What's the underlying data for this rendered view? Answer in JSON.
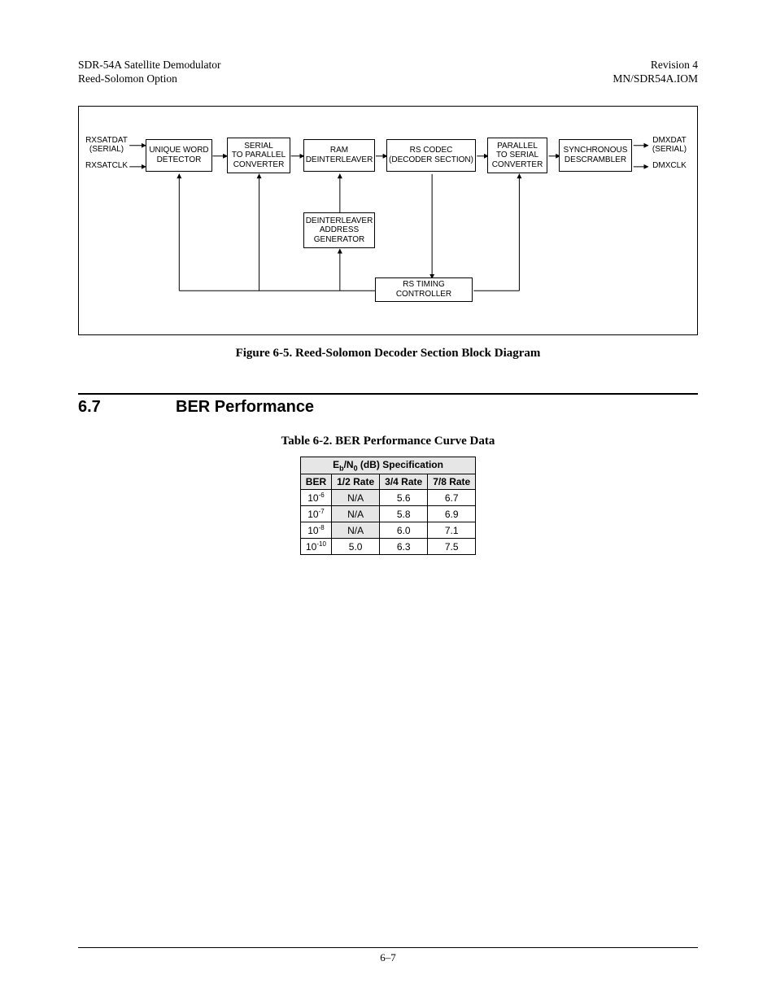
{
  "header": {
    "left1": "SDR-54A Satellite Demodulator",
    "left2": "Reed-Solomon Option",
    "right1": "Revision 4",
    "right2": "MN/SDR54A.IOM"
  },
  "diagram": {
    "inputs": {
      "rxsatdat": "RXSATDAT\n(SERIAL)",
      "rxsatclk": "RXSATCLK"
    },
    "outputs": {
      "dmxdat": "DMXDAT\n(SERIAL)",
      "dmxclk": "DMXCLK"
    },
    "blocks": {
      "uwd": "UNIQUE WORD\nDETECTOR",
      "spc": "SERIAL\nTO PARALLEL\nCONVERTER",
      "ram": "RAM\nDEINTERLEAVER",
      "rsc": "RS CODEC\n(DECODER SECTION)",
      "psc": "PARALLEL\nTO SERIAL\nCONVERTER",
      "desc": "SYNCHRONOUS\nDESCRAMBLER",
      "dag": "DEINTERLEAVER\nADDRESS\nGENERATOR",
      "rtc": "RS TIMING CONTROLLER"
    }
  },
  "figure_caption": "Figure 6-5.  Reed-Solomon Decoder Section Block Diagram",
  "section": {
    "num": "6.7",
    "title": "BER Performance"
  },
  "table_caption": "Table 6-2.  BER Performance Curve Data",
  "chart_data": {
    "type": "table",
    "title": "Eb/N0 (dB) Specification",
    "columns": [
      "BER",
      "1/2 Rate",
      "3/4 Rate",
      "7/8 Rate"
    ],
    "rows": [
      {
        "ber_base": "10",
        "ber_exp": "-6",
        "half": "N/A",
        "three_quarter": "5.6",
        "seven_eighth": "6.7",
        "shade_half": true
      },
      {
        "ber_base": "10",
        "ber_exp": "-7",
        "half": "N/A",
        "three_quarter": "5.8",
        "seven_eighth": "6.9",
        "shade_half": true
      },
      {
        "ber_base": "10",
        "ber_exp": "-8",
        "half": "N/A",
        "three_quarter": "6.0",
        "seven_eighth": "7.1",
        "shade_half": true
      },
      {
        "ber_base": "10",
        "ber_exp": "-10",
        "half": "5.0",
        "three_quarter": "6.3",
        "seven_eighth": "7.5",
        "shade_half": false
      }
    ]
  },
  "footer": "6–7"
}
